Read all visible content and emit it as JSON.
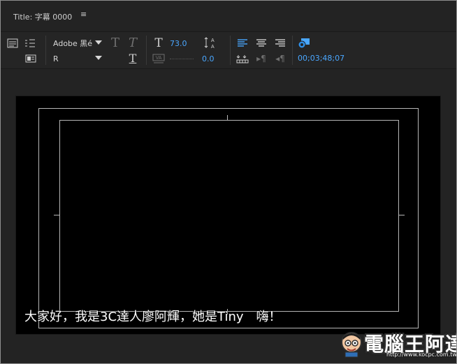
{
  "window": {
    "title": "Title: 字幕 0000"
  },
  "toolbar": {
    "font_family": "Adobe 黑é",
    "font_style": "R",
    "font_size": "73.0",
    "kerning": "0.0",
    "timecode": "00;03;48;07"
  },
  "canvas": {
    "subtitle": "大家好，我是3C達人廖阿輝，她是Tiny　嗨！"
  },
  "watermark": {
    "text": "電腦王阿達",
    "url": "http://www.kocpc.com.tw"
  },
  "icons": {
    "title_menu": "hamburger-icon",
    "new_title": "new-title-icon",
    "tab_stops": "tab-stops-icon",
    "templates": "templates-icon",
    "bold": "bold-icon",
    "italic": "italic-icon",
    "underline": "underline-icon",
    "font_size": "font-size-icon",
    "leading": "leading-icon",
    "kerning": "kerning-icon",
    "align_left": "align-left-icon",
    "align_center": "align-center-icon",
    "align_right": "align-right-icon",
    "show_background": "show-background-icon",
    "small_caps": "small-caps-icon",
    "tab_left": "tab-left-icon",
    "tab_right": "tab-right-icon"
  },
  "colors": {
    "accent": "#4aa7ff",
    "panel": "#252525",
    "canvas": "#000000",
    "guide": "#b7b7b7"
  }
}
